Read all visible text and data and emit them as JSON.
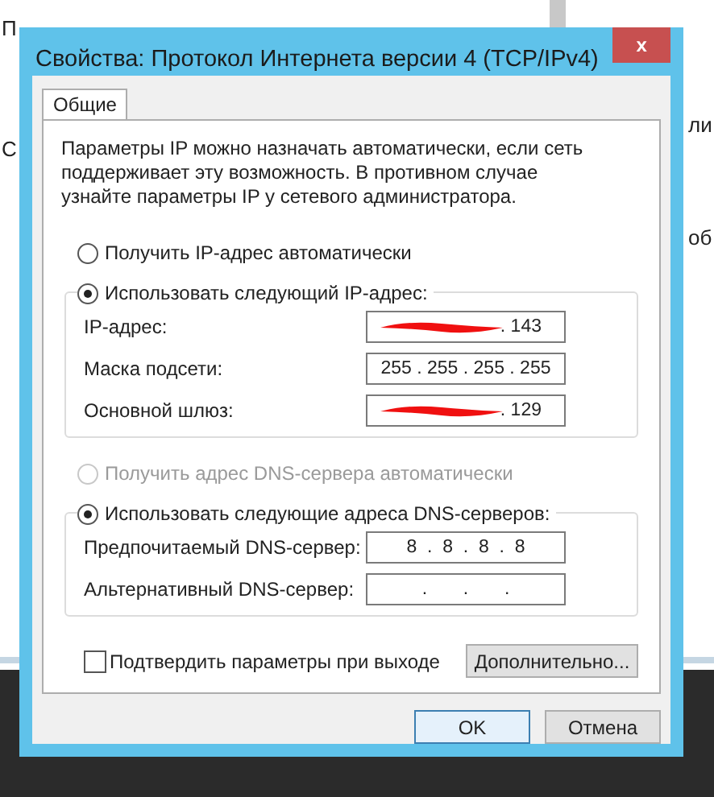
{
  "background": {
    "fragments": [
      {
        "text": "П"
      },
      {
        "text": "С"
      },
      {
        "text": "ли"
      },
      {
        "text": "об"
      }
    ]
  },
  "window": {
    "title": "Свойства: Протокол Интернета версии 4 (TCP/IPv4)",
    "close": "x"
  },
  "tabs": [
    {
      "label": "Общие",
      "selected": true
    }
  ],
  "description": "Параметры IP можно назначать автоматически, если сеть поддерживает эту возможность. В противном случае узнайте параметры IP у сетевого администратора.",
  "ip_mode": [
    {
      "label": "Получить IP-адрес автоматически",
      "selected": false,
      "disabled": false
    },
    {
      "label": "Использовать следующий IP-адрес:",
      "selected": true,
      "disabled": false
    }
  ],
  "ip_fields": [
    {
      "label": "IP-адрес:",
      "value": ". 143",
      "redacted": true
    },
    {
      "label": "Маска подсети:",
      "value": "255 . 255 . 255 . 255",
      "redacted": false
    },
    {
      "label": "Основной шлюз:",
      "value": ". 129",
      "redacted": true
    }
  ],
  "dns_mode": [
    {
      "label": "Получить адрес DNS-сервера автоматически",
      "selected": false,
      "disabled": true
    },
    {
      "label": "Использовать следующие адреса DNS-серверов:",
      "selected": true,
      "disabled": false
    }
  ],
  "dns_fields": [
    {
      "label": "Предпочитаемый DNS-сервер:",
      "value": "8  .  8  .  8  .  8",
      "redacted": false
    },
    {
      "label": "Альтернативный DNS-сервер:",
      "value": ".       .       .",
      "redacted": false
    }
  ],
  "confirm": {
    "label": "Подтвердить параметры при выходе",
    "checked": false
  },
  "advanced_button": "Дополнительно...",
  "buttons": [
    {
      "label": "OK",
      "default": true
    },
    {
      "label": "Отмена",
      "default": false
    }
  ]
}
